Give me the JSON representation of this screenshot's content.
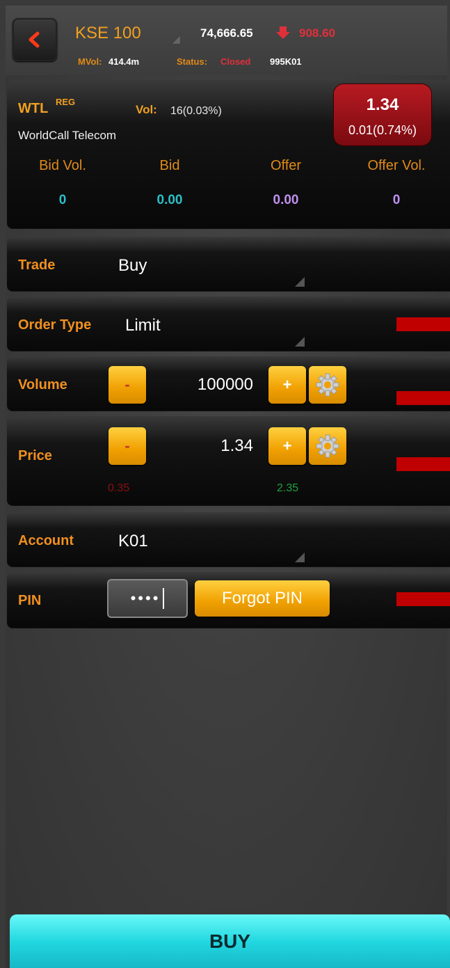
{
  "header": {
    "index_name": "KSE 100",
    "index_value": "74,666.65",
    "index_change": "908.60",
    "mvol_label": "MVol:",
    "mvol_value": "414.4m",
    "status_label": "Status:",
    "status_value": "Closed",
    "account_code": "995K01"
  },
  "quote": {
    "symbol": "WTL",
    "market": "REG",
    "vol_label": "Vol:",
    "vol_value": "16(0.03%)",
    "company": "WorldCall Telecom",
    "last_price": "1.34",
    "change": "0.01(0.74%)",
    "columns": [
      "Bid Vol.",
      "Bid",
      "Offer",
      "Offer Vol."
    ],
    "values": [
      "0",
      "0.00",
      "0.00",
      "0"
    ]
  },
  "form": {
    "trade_label": "Trade",
    "trade_value": "Buy",
    "order_type_label": "Order Type",
    "order_type_value": "Limit",
    "volume_label": "Volume",
    "volume_value": "100000",
    "price_label": "Price",
    "price_value": "1.34",
    "price_lower_limit": "0.35",
    "price_upper_limit": "2.35",
    "account_label": "Account",
    "account_value": "K01",
    "pin_label": "PIN",
    "pin_value": "••••",
    "forgot_pin_label": "Forgot PIN",
    "minus_label": "-",
    "plus_label": "+"
  },
  "buy_button_label": "BUY",
  "colors": {
    "accent_orange": "#f0a020",
    "down_red": "#e0303a",
    "buy_cyan": "#22d8e0"
  }
}
